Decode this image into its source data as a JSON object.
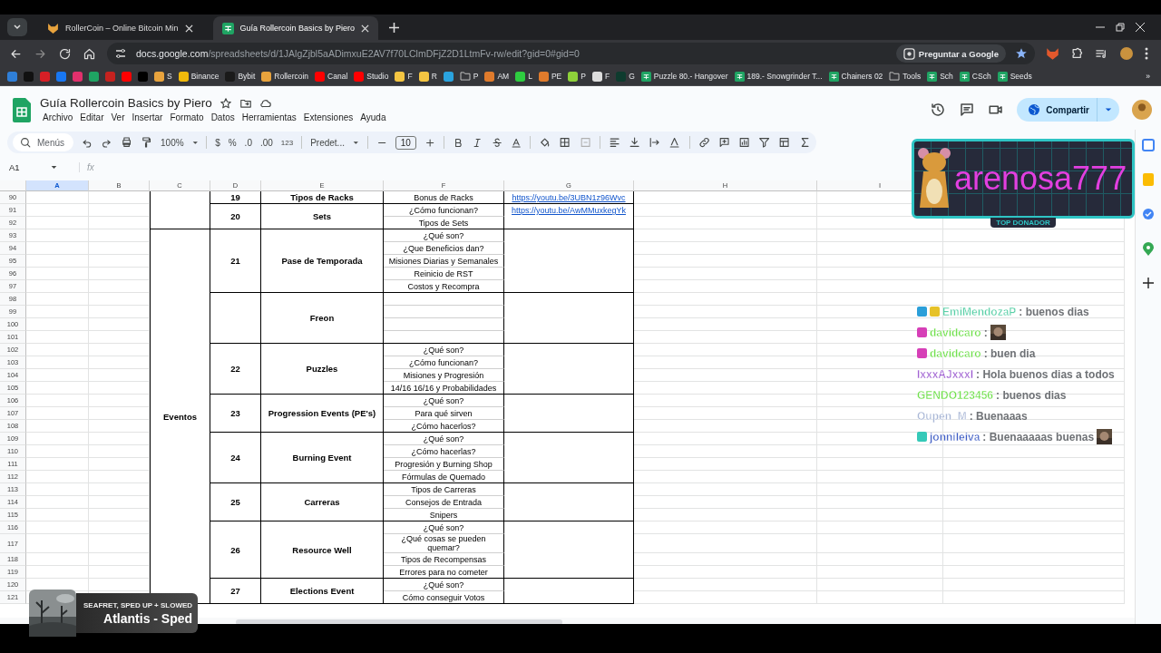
{
  "browser": {
    "tabs": [
      {
        "title": "RollerCoin – Online Bitcoin Min",
        "selected": false
      },
      {
        "title": "Guía Rollercoin Basics by Piero",
        "selected": true
      }
    ],
    "address": {
      "host": "docs.google.com",
      "path": "/spreadsheets/d/1JAlgZjbl5aADimxuE2AV7f70LClmDFjZ2D1LtmFv-rw/edit?gid=0#gid=0"
    },
    "ask_google": "Preguntar a Google",
    "bookmarks": [
      {
        "kind": "site",
        "color": "#2f7fd8"
      },
      {
        "kind": "site",
        "color": "#111111"
      },
      {
        "kind": "site",
        "color": "#d81f26"
      },
      {
        "kind": "site",
        "color": "#1877f2"
      },
      {
        "kind": "site",
        "color": "#e1306c"
      },
      {
        "kind": "site",
        "color": "#1fa463"
      },
      {
        "kind": "site",
        "color": "#c5221f"
      },
      {
        "kind": "site",
        "color": "#ff0000"
      },
      {
        "kind": "site",
        "color": "#000000"
      },
      {
        "kind": "site",
        "color": "#e8a33d",
        "label": "S"
      },
      {
        "kind": "site",
        "color": "#f0b90b",
        "label": "Binance"
      },
      {
        "kind": "site",
        "color": "#1a1a1a",
        "label": "Bybit"
      },
      {
        "kind": "site",
        "color": "#e8a33d",
        "label": "Rollercoin"
      },
      {
        "kind": "site",
        "color": "#ff0000",
        "label": "Canal"
      },
      {
        "kind": "site",
        "color": "#ff0000",
        "label": "Studio"
      },
      {
        "kind": "site",
        "color": "#f4c542",
        "label": "F"
      },
      {
        "kind": "site",
        "color": "#f4c542",
        "label": "R"
      },
      {
        "kind": "site",
        "color": "#2aa3df"
      },
      {
        "kind": "folder",
        "label": "P"
      },
      {
        "kind": "site",
        "color": "#e07b2c",
        "label": "AM"
      },
      {
        "kind": "site",
        "color": "#2ecc40",
        "label": "L"
      },
      {
        "kind": "site",
        "color": "#e07b2c",
        "label": "PE"
      },
      {
        "kind": "site",
        "color": "#8ed13a",
        "label": "P"
      },
      {
        "kind": "site",
        "color": "#dddddd",
        "label": "F"
      },
      {
        "kind": "site",
        "color": "#0e3b2e",
        "label": "G"
      },
      {
        "kind": "sheet",
        "label": "Puzzle 80.- Hangover"
      },
      {
        "kind": "sheet",
        "label": "189.- Snowgrinder T..."
      },
      {
        "kind": "sheet",
        "label": "Chainers 02"
      },
      {
        "kind": "folder",
        "label": "Tools"
      },
      {
        "kind": "sheet",
        "label": "Sch"
      },
      {
        "kind": "sheet",
        "label": "CSch"
      },
      {
        "kind": "sheet",
        "label": "Seeds"
      }
    ],
    "more_bookmarks": "»"
  },
  "doc": {
    "title": "Guía Rollercoin Basics by Piero",
    "menu": [
      "Archivo",
      "Editar",
      "Ver",
      "Insertar",
      "Formato",
      "Datos",
      "Herramientas",
      "Extensiones",
      "Ayuda"
    ],
    "share": "Compartir"
  },
  "toolbar": {
    "search_placeholder": "Menús",
    "zoom": "100%",
    "currency": "$",
    "percent": "%",
    "dec_less": ".0",
    "dec_more": ".00",
    "more_formats": "123",
    "font": "Predet...",
    "font_size": "10"
  },
  "name_box": "A1",
  "formula_icon": "fx",
  "columns": [
    {
      "label": "A",
      "selected": true
    },
    {
      "label": "B",
      "selected": false
    },
    {
      "label": "C",
      "selected": false
    },
    {
      "label": "D",
      "selected": false
    },
    {
      "label": "E",
      "selected": false
    },
    {
      "label": "F",
      "selected": false
    },
    {
      "label": "G",
      "selected": false
    },
    {
      "label": "H",
      "selected": false
    },
    {
      "label": "I",
      "selected": false
    }
  ],
  "groups": [
    {
      "sections": [
        {
          "number": "19",
          "title": "Tipos de Racks",
          "link": "https://youtu.be/3UBN1z96Wvc",
          "items": [
            {
              "row": "90",
              "text": "Bonus de Racks"
            }
          ]
        },
        {
          "number": "20",
          "title": "Sets",
          "link": "https://youtu.be/AwMMuxkegYk",
          "items": [
            {
              "row": "91",
              "text": "¿Cómo funcionan?"
            },
            {
              "row": "92",
              "text": "Tipos de Sets"
            }
          ]
        }
      ]
    },
    {
      "label": "Eventos",
      "sections": [
        {
          "number": "21",
          "title": "Pase de Temporada",
          "items": [
            {
              "row": "93",
              "text": "¿Qué son?"
            },
            {
              "row": "94",
              "text": "¿Que Beneficios dan?"
            },
            {
              "row": "95",
              "text": "Misiones Diarias y Semanales"
            },
            {
              "row": "96",
              "text": "Reinicio de RST"
            },
            {
              "row": "97",
              "text": "Costos y Recompra"
            }
          ]
        },
        {
          "title": "Freon",
          "items": [
            {
              "row": "98"
            },
            {
              "row": "99"
            },
            {
              "row": "100"
            },
            {
              "row": "101"
            }
          ]
        },
        {
          "number": "22",
          "title": "Puzzles",
          "items": [
            {
              "row": "102",
              "text": "¿Qué son?"
            },
            {
              "row": "103",
              "text": "¿Cómo funcionan?"
            },
            {
              "row": "104",
              "text": "Misiones y Progresión"
            },
            {
              "row": "105",
              "text": "14/16 16/16 y Probabilidades"
            }
          ]
        },
        {
          "number": "23",
          "title": "Progression Events (PE's)",
          "items": [
            {
              "row": "106",
              "text": "¿Qué son?"
            },
            {
              "row": "107",
              "text": "Para qué sirven"
            },
            {
              "row": "108",
              "text": "¿Cómo hacerlos?"
            }
          ]
        },
        {
          "number": "24",
          "title": "Burning Event",
          "items": [
            {
              "row": "109",
              "text": "¿Qué son?"
            },
            {
              "row": "110",
              "text": "¿Cómo hacerlas?"
            },
            {
              "row": "111",
              "text": "Progresión y Burning Shop"
            },
            {
              "row": "112",
              "text": "Fórmulas de Quemado"
            }
          ]
        },
        {
          "number": "25",
          "title": "Carreras",
          "items": [
            {
              "row": "113",
              "text": "Tipos de Carreras"
            },
            {
              "row": "114",
              "text": "Consejos de Entrada"
            },
            {
              "row": "115",
              "text": "Snipers"
            }
          ]
        },
        {
          "number": "26",
          "title": "Resource Well",
          "items": [
            {
              "row": "116",
              "text": "¿Qué son?"
            },
            {
              "row": "117",
              "text": "¿Qué cosas se pueden quemar?"
            },
            {
              "row": "118",
              "text": "Tipos de Recompensas"
            },
            {
              "row": "119",
              "text": "Errores para no cometer"
            }
          ]
        },
        {
          "number": "27",
          "title": "Elections Event",
          "items": [
            {
              "row": "120",
              "text": "¿Qué son?"
            },
            {
              "row": "121",
              "text": "Cómo conseguir Votos"
            }
          ]
        }
      ]
    }
  ],
  "donor": {
    "name": "arenosa777",
    "badge": "TOP DONADOR"
  },
  "chat": [
    {
      "badges": [
        {
          "color": "#2b9fd9"
        },
        {
          "color": "#e6c229"
        }
      ],
      "user": "EmiMendozaP",
      "color": "#5ad0a8",
      "text": ": buenos dias"
    },
    {
      "badges": [
        {
          "color": "#d63fb7"
        }
      ],
      "user": "davidcaro",
      "color": "#6ee04a",
      "text": ":",
      "emote": true
    },
    {
      "badges": [
        {
          "color": "#d63fb7"
        }
      ],
      "user": "davidcaro",
      "color": "#6ee04a",
      "text": ": buen dia"
    },
    {
      "user": "lxxxAJxxxl",
      "color": "#9b59d0",
      "text": ": Hola buenos dias a todos"
    },
    {
      "user": "GENDO123456",
      "color": "#6ee04a",
      "text": ": buenos dias"
    },
    {
      "user": "Oupen_M",
      "color": "#a9b7d6",
      "text": ": Buenaaas"
    },
    {
      "badges": [
        {
          "color": "#35c9b8"
        }
      ],
      "user": "jonnileiva",
      "color": "#3d5cc4",
      "text": ": Buenaaaaas buenas",
      "emote": true
    }
  ],
  "now_playing": {
    "artist": "SEAFRET, SPED UP + SLOWED",
    "title": "Atlantis - Sped"
  }
}
